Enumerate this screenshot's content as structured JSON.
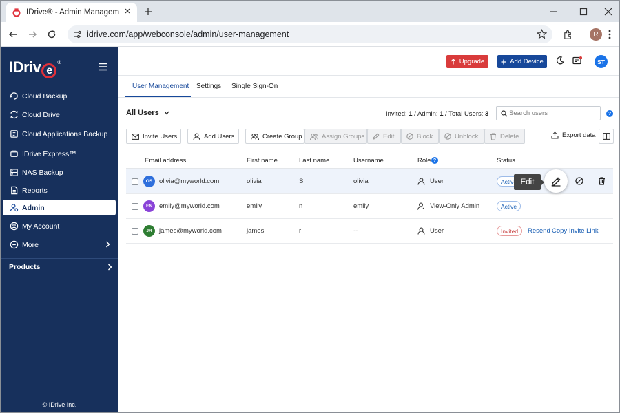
{
  "browser": {
    "tab_title": "IDrive® - Admin Management",
    "url": "idrive.com/app/webconsole/admin/user-management",
    "profile_initial": "R"
  },
  "sidebar": {
    "logo": "IDriv",
    "logo_e": "e",
    "logo_reg": "®",
    "items": [
      {
        "label": "Cloud Backup",
        "icon": "cloud-backup-icon"
      },
      {
        "label": "Cloud Drive",
        "icon": "cloud-drive-icon"
      },
      {
        "label": "Cloud Applications Backup",
        "icon": "apps-backup-icon"
      },
      {
        "label": "IDrive Express™",
        "icon": "express-icon"
      },
      {
        "label": "NAS Backup",
        "icon": "nas-icon"
      },
      {
        "label": "Reports",
        "icon": "reports-icon"
      },
      {
        "label": "Admin",
        "icon": "admin-icon"
      },
      {
        "label": "My Account",
        "icon": "account-icon"
      },
      {
        "label": "More",
        "icon": "more-icon"
      }
    ],
    "products_label": "Products",
    "copyright": "© IDrive Inc."
  },
  "header": {
    "upgrade_label": "Upgrade",
    "add_device_label": "Add Device",
    "user_initials": "ST"
  },
  "tabs": [
    "User Management",
    "Settings",
    "Single Sign-On"
  ],
  "filter": {
    "label": "All Users",
    "counts": {
      "invited_label": "Invited:",
      "invited": "1",
      "admin_label": "/ Admin:",
      "admin": "1",
      "total_label": "/ Total Users:",
      "total": "3"
    },
    "search_placeholder": "Search users"
  },
  "actions": {
    "invite": "Invite Users",
    "add": "Add Users",
    "create_group": "Create Group",
    "assign_groups": "Assign Groups",
    "edit": "Edit",
    "block": "Block",
    "unblock": "Unblock",
    "delete": "Delete",
    "export": "Export data"
  },
  "table": {
    "headers": {
      "email": "Email address",
      "first": "First name",
      "last": "Last name",
      "username": "Username",
      "role": "Role",
      "status": "Status"
    },
    "rows": [
      {
        "initials": "OS",
        "avatar_color": "#2f6fdc",
        "email": "olivia@myworld.com",
        "first": "olivia",
        "last": "S",
        "username": "olivia",
        "role": "User",
        "status": "Active"
      },
      {
        "initials": "EN",
        "avatar_color": "#8a43d8",
        "email": "emily@myworld.com",
        "first": "emily",
        "last": "n",
        "username": "emily",
        "role": "View-Only Admin",
        "status": "Active"
      },
      {
        "initials": "JR",
        "avatar_color": "#2e7d32",
        "email": "james@myworld.com",
        "first": "james",
        "last": "r",
        "username": "--",
        "role": "User",
        "status": "Invited",
        "resend": "Resend",
        "copy_link": "Copy Invite Link"
      }
    ]
  },
  "tooltip": "Edit"
}
